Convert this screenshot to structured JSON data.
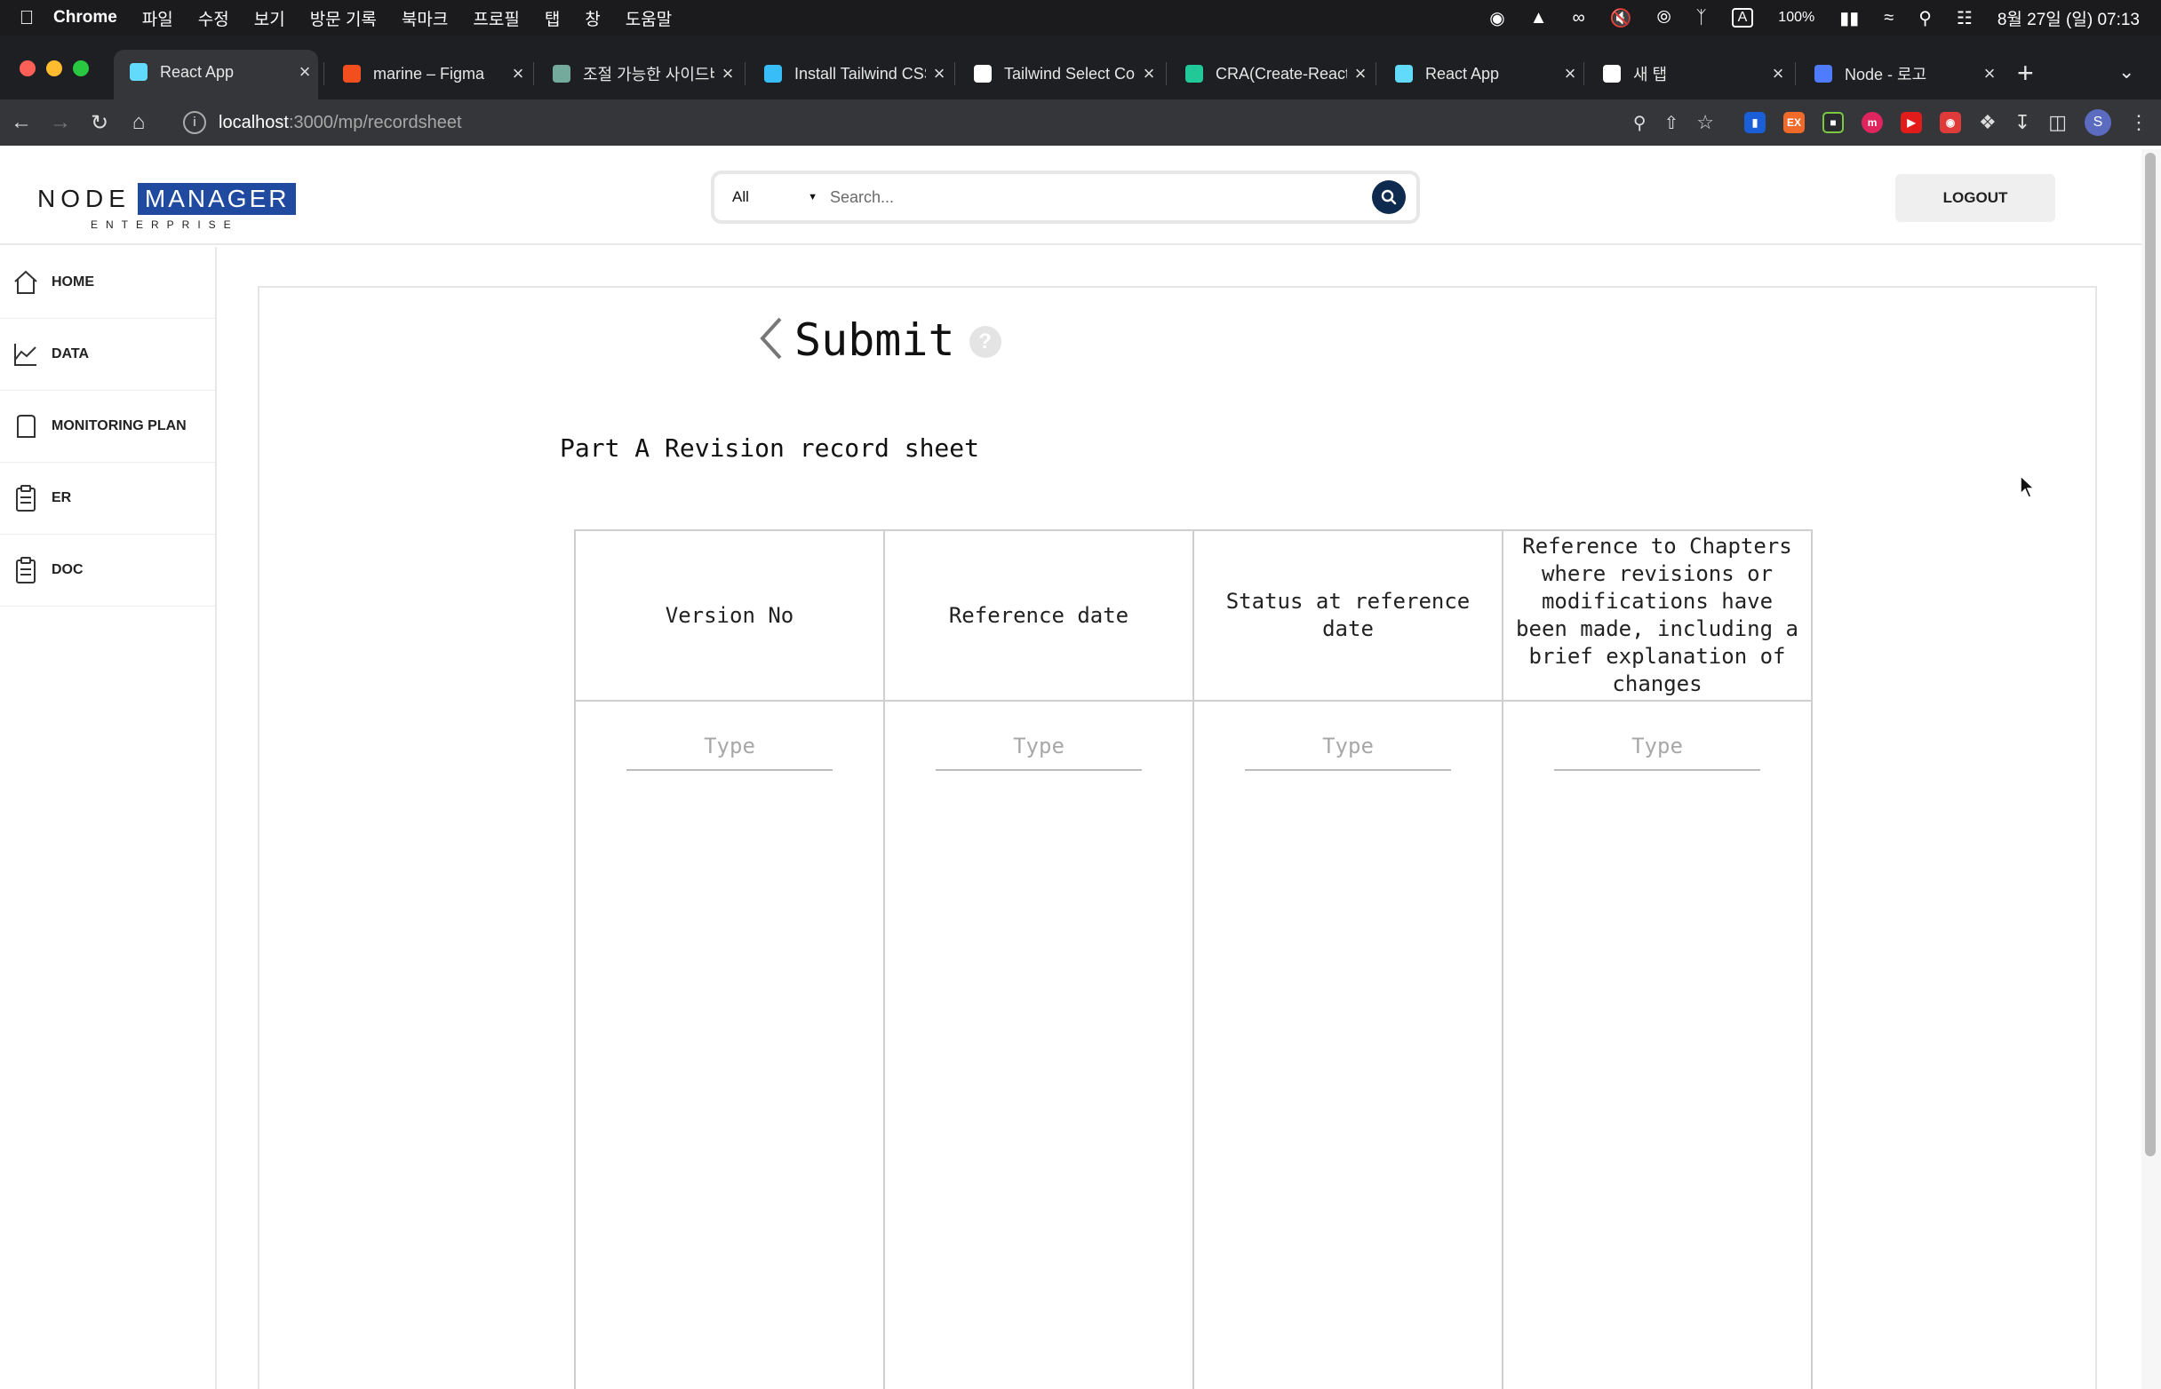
{
  "menubar": {
    "app": "Chrome",
    "items": [
      "파일",
      "수정",
      "보기",
      "방문 기록",
      "북마크",
      "프로필",
      "탭",
      "창",
      "도움말"
    ],
    "input_indicator": "A",
    "battery": "100%",
    "datetime": "8월 27일 (일) 07:13"
  },
  "tabs": [
    {
      "title": "React App",
      "favicon": "react-icon",
      "color": "#61dafb"
    },
    {
      "title": "marine – Figma",
      "favicon": "figma-icon",
      "color": "#f24e1e"
    },
    {
      "title": "조절 가능한 사이드바",
      "favicon": "chatgpt-icon",
      "color": "#74aa9c"
    },
    {
      "title": "Install Tailwind CSS",
      "favicon": "tailwind-icon",
      "color": "#38bdf8"
    },
    {
      "title": "Tailwind Select Co",
      "favicon": "github-icon",
      "color": "#ffffff"
    },
    {
      "title": "CRA(Create-React",
      "favicon": "velog-icon",
      "color": "#20c997"
    },
    {
      "title": "React App",
      "favicon": "react-icon",
      "color": "#61dafb"
    },
    {
      "title": "새 탭",
      "favicon": "chrome-icon",
      "color": "#ffffff"
    },
    {
      "title": "Node - 로고",
      "favicon": "canva-icon",
      "color": "#4f7cff"
    }
  ],
  "address": {
    "host": "localhost",
    "path": ":3000/mp/recordsheet"
  },
  "header": {
    "logo_primary": "NODE",
    "logo_highlight": "MANAGER",
    "logo_sub": "ENTERPRISE",
    "search_scope": "All",
    "search_placeholder": "Search...",
    "logout_label": "LOGOUT"
  },
  "sidebar": {
    "items": [
      {
        "label": "HOME",
        "icon": "home-icon"
      },
      {
        "label": "DATA",
        "icon": "chart-icon"
      },
      {
        "label": "MONITORING PLAN",
        "icon": "document-icon"
      },
      {
        "label": "ER",
        "icon": "clipboard-icon"
      },
      {
        "label": "DOC",
        "icon": "clipboard-icon"
      }
    ]
  },
  "page": {
    "title": "Submit",
    "help": "?",
    "section_title": "Part A Revision record sheet",
    "table": {
      "headers": [
        "Version No",
        "Reference date",
        "Status at reference date",
        "Reference to Chapters where revisions or modifications have been made, including a brief explanation of changes"
      ],
      "input_placeholder": "Type"
    }
  }
}
